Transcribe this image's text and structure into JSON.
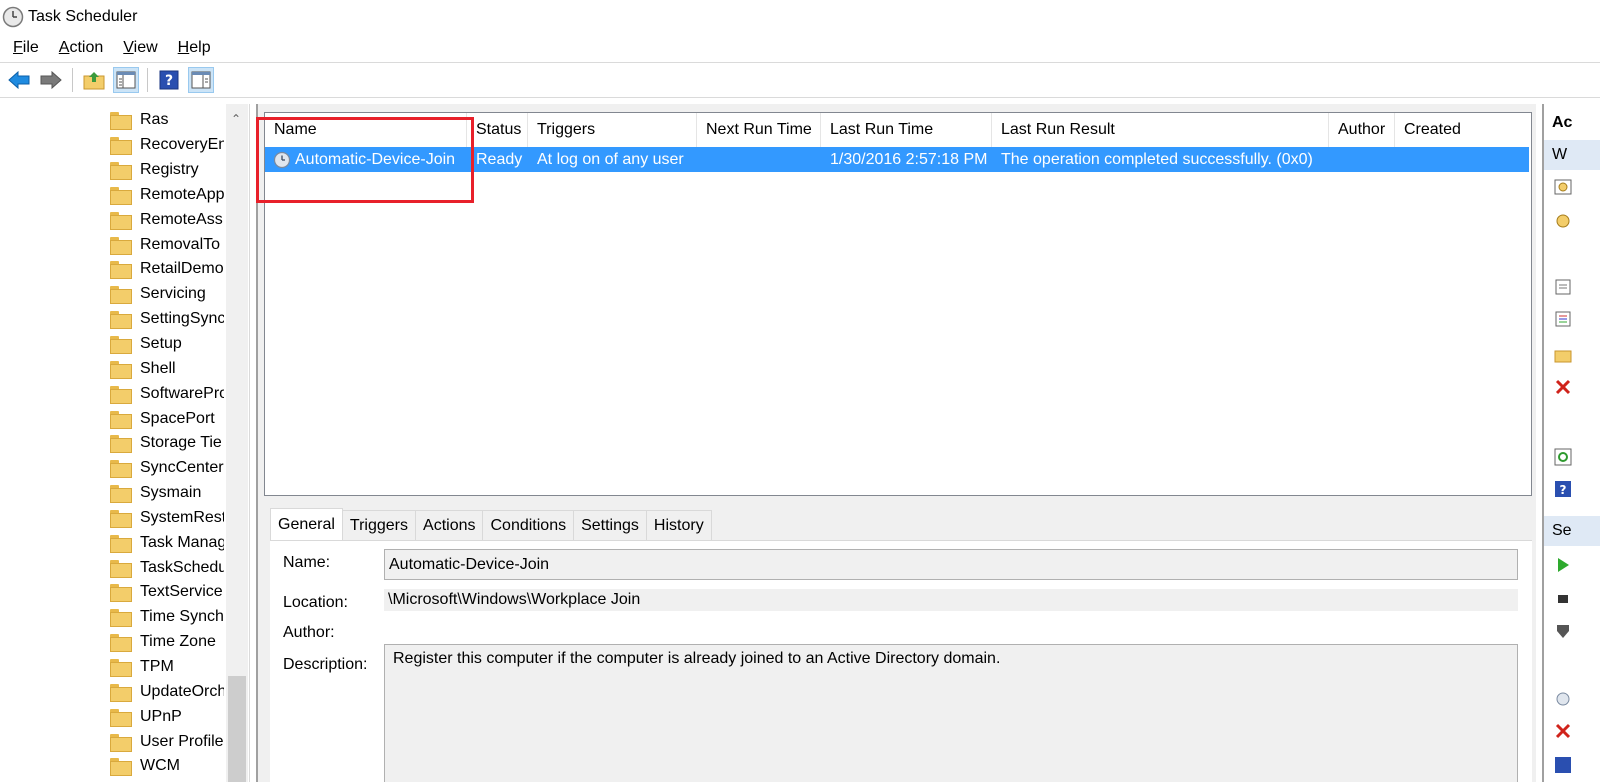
{
  "window": {
    "title": "Task Scheduler"
  },
  "menu": {
    "file": {
      "ul": "F",
      "rest": "ile"
    },
    "action": {
      "ul": "A",
      "rest": "ction"
    },
    "view": {
      "ul": "V",
      "rest": "iew"
    },
    "help": {
      "ul": "H",
      "rest": "elp"
    }
  },
  "toolbar": {
    "buttons": [
      "back-icon",
      "forward-icon",
      "up-folder-icon",
      "show-hide-console-tree-icon",
      "help-icon",
      "show-hide-action-pane-icon"
    ]
  },
  "tree": {
    "items": [
      "Ras",
      "RecoveryEn",
      "Registry",
      "RemoteApp",
      "RemoteAss",
      "RemovalTo",
      "RetailDemo",
      "Servicing",
      "SettingSync",
      "Setup",
      "Shell",
      "SoftwarePro",
      "SpacePort",
      "Storage Tie",
      "SyncCenter",
      "Sysmain",
      "SystemRest",
      "Task Manag",
      "TaskSchedu",
      "TextService",
      "Time Synch",
      "Time Zone",
      "TPM",
      "UpdateOrch",
      "UPnP",
      "User Profile",
      "WCM"
    ]
  },
  "tasklist": {
    "columns": [
      "Name",
      "Status",
      "Triggers",
      "Next Run Time",
      "Last Run Time",
      "Last Run Result",
      "Author",
      "Created"
    ],
    "rows": [
      {
        "name": "Automatic-Device-Join",
        "status": "Ready",
        "triggers": "At log on of any user",
        "next_run_time": "",
        "last_run_time": "1/30/2016 2:57:18 PM",
        "last_run_result": "The operation completed successfully. (0x0)",
        "author": "",
        "created": ""
      }
    ]
  },
  "details": {
    "tabs": [
      "General",
      "Triggers",
      "Actions",
      "Conditions",
      "Settings",
      "History"
    ],
    "active_tab": "General",
    "labels": {
      "name": "Name:",
      "location": "Location:",
      "author": "Author:",
      "description": "Description:"
    },
    "values": {
      "name": "Automatic-Device-Join",
      "location": "\\Microsoft\\Windows\\Workplace Join",
      "author": "",
      "description": "Register this computer if the computer is already joined to an Active Directory domain."
    }
  },
  "actions_pane": {
    "header": "Ac",
    "section1": "W",
    "section2": "Se"
  },
  "colors": {
    "selection": "#3399ff",
    "highlight_box": "#e8202a"
  }
}
